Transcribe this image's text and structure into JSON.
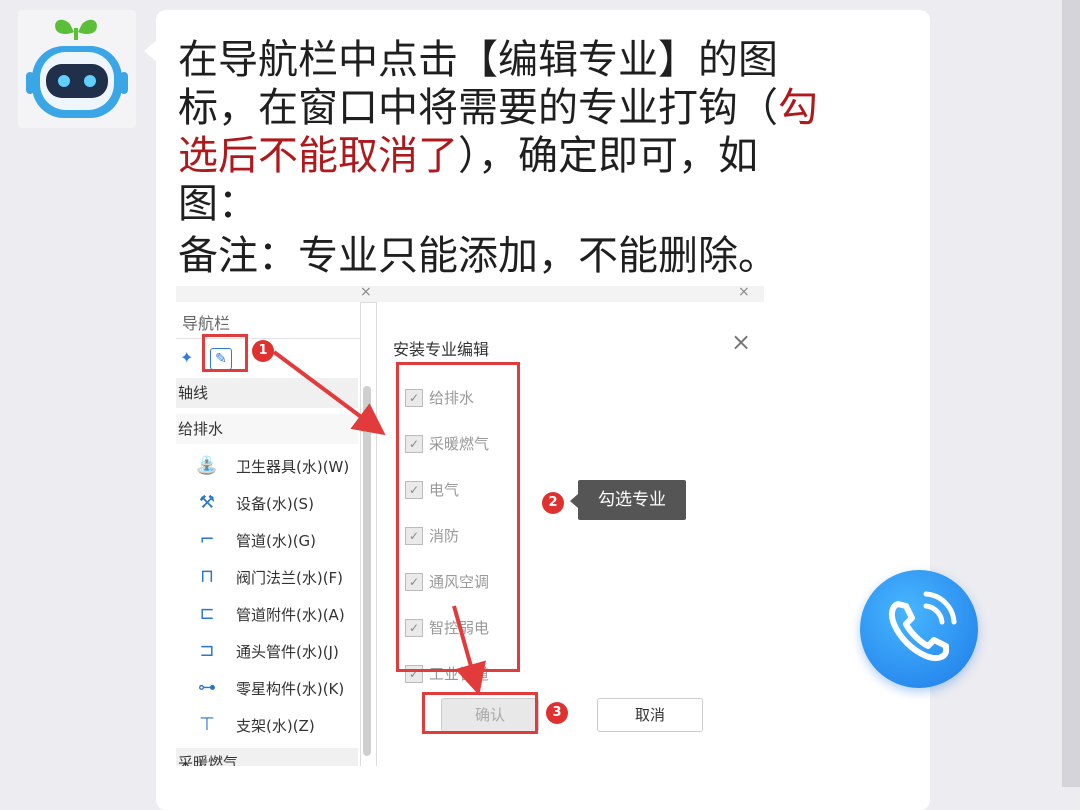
{
  "message": {
    "line1": "在导航栏中点击【编辑专业】的图",
    "line2_start": "标，在窗口中将需要的专业打钩（",
    "line2_red": "勾",
    "line3_red": "选后不能取消了",
    "line3_end": "），确定即可，如",
    "line4": "图：",
    "note": "备注：专业只能添加，不能删除。"
  },
  "screenshot": {
    "nav_panel": {
      "title": "导航栏",
      "groups": [
        "轴线",
        "给排水"
      ],
      "items": [
        {
          "label": "卫生器具(水)(W)",
          "icon": "toilet-icon"
        },
        {
          "label": "设备(水)(S)",
          "icon": "equipment-icon"
        },
        {
          "label": "管道(水)(G)",
          "icon": "pipe-icon"
        },
        {
          "label": "阀门法兰(水)(F)",
          "icon": "valve-icon"
        },
        {
          "label": "管道附件(水)(A)",
          "icon": "pipe-fitting-icon"
        },
        {
          "label": "通头管件(水)(J)",
          "icon": "tee-fitting-icon"
        },
        {
          "label": "零星构件(水)(K)",
          "icon": "component-icon"
        },
        {
          "label": "支架(水)(Z)",
          "icon": "bracket-icon"
        }
      ],
      "bottom_group": "采暖燃气"
    },
    "dialog": {
      "title": "安装专业编辑",
      "options": [
        "给排水",
        "采暖燃气",
        "电气",
        "消防",
        "通风空调",
        "智控弱电",
        "工业管道"
      ],
      "confirm_label": "确认",
      "cancel_label": "取消"
    },
    "tooltip": "勾选专业",
    "step_numbers": [
      "1",
      "2",
      "3"
    ],
    "accent_red": "#e23b3b"
  },
  "call_button": {
    "icon": "phone-call-icon",
    "color": "#1d7be8"
  }
}
